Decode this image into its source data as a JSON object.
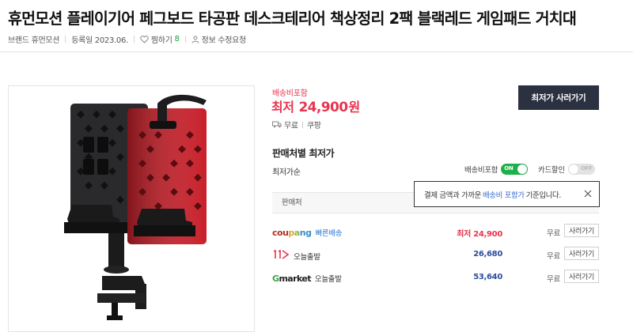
{
  "product": {
    "title": "휴먼모션 플레이기어 페그보드 타공판 데스크테리어 책상정리 2팩 블랙레드 게임패드 거치대"
  },
  "meta": {
    "brand": "브랜드 휴먼모션",
    "registered": "등록일 2023.06.",
    "wish_label": "찜하기",
    "wish_count": "8",
    "report": "정보 수정요청"
  },
  "price": {
    "shipping_label": "배송비포함",
    "prefix": "최저",
    "value": "24,900",
    "unit": "원",
    "buy_button": "최저가 사러가기",
    "delivery": [
      "무료",
      "쿠팡"
    ]
  },
  "sellers_section": {
    "title": "판매처별 최저가",
    "sort_label": "최저가순",
    "toggle_shipping": {
      "label": "배송비포함",
      "state": "ON"
    },
    "toggle_card": {
      "label": "카드할인",
      "state": "OFF"
    },
    "table_header": "판매처",
    "tooltip": {
      "before": "결제 금액과 가까운",
      "highlight": "배송비 포함가",
      "after": "기준입니다."
    },
    "rows": [
      {
        "seller_logo": "coupang",
        "seller_sub": "빠른배송",
        "price_prefix": "최저",
        "price": "24,900",
        "shipping": "무료",
        "button": "사러가기"
      },
      {
        "seller_logo": "11번가",
        "seller_sub": "오늘출발",
        "price_prefix": "",
        "price": "26,680",
        "shipping": "무료",
        "button": "사러가기"
      },
      {
        "seller_logo": "Gmarket",
        "seller_sub": "오늘출발",
        "price_prefix": "",
        "price": "53,640",
        "shipping": "무료",
        "button": "사러가기"
      }
    ]
  },
  "colors": {
    "accent_red": "#e8344e",
    "price_blue": "#2b4d9e",
    "button_dark": "#2b3140",
    "toggle_green": "#1fb04b",
    "link_blue": "#3c6fd1"
  }
}
